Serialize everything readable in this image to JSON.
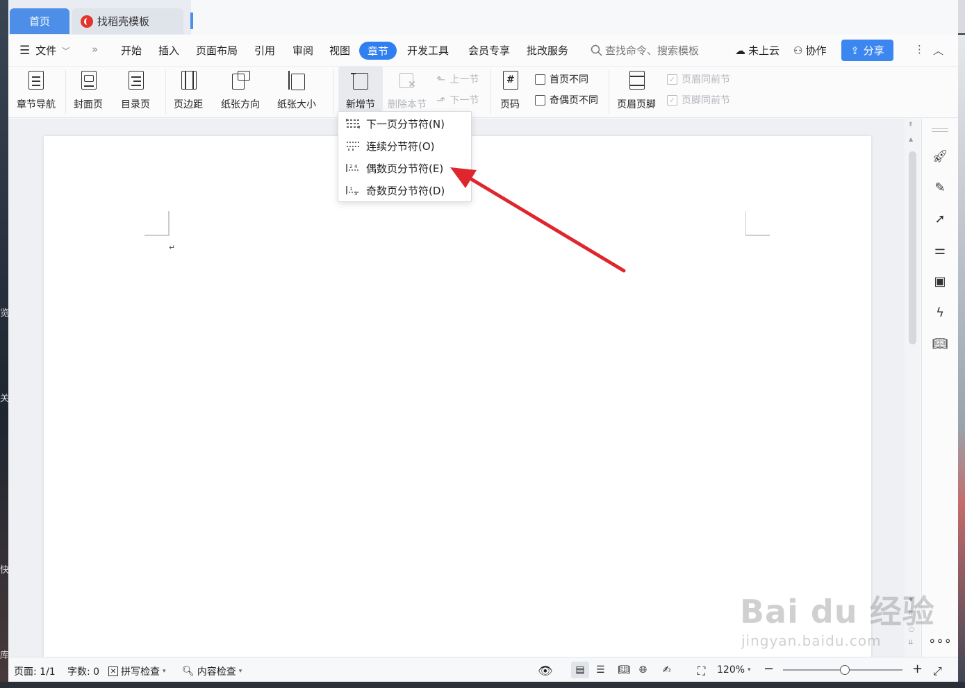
{
  "window": {
    "tabs": [
      {
        "label": "首页"
      },
      {
        "label": "找稻壳模板"
      }
    ]
  },
  "menubar": {
    "file": "文件",
    "items": [
      "开始",
      "插入",
      "页面布局",
      "引用",
      "审阅",
      "视图"
    ],
    "active": "章节",
    "items_after": [
      "开发工具",
      "会员专享",
      "批改服务"
    ],
    "search_placeholder": "查找命令、搜索模板",
    "cloud": "未上云",
    "collab": "协作",
    "share": "分享"
  },
  "ribbon": {
    "nav": "章节导航",
    "cover": "封面页",
    "toc": "目录页",
    "margin": "页边距",
    "orientation": "纸张方向",
    "size": "纸张大小",
    "new_section": "新增节",
    "delete_section": "删除本节",
    "prev_section": "上一节",
    "next_section": "下一节",
    "page_number": "页码",
    "first_page_diff": "首页不同",
    "odd_even_diff": "奇偶页不同",
    "header_footer": "页眉页脚",
    "header_same_prev": "页眉同前节",
    "footer_same_prev": "页脚同前节"
  },
  "dropdown": {
    "items": [
      {
        "label": "下一页分节符(N)"
      },
      {
        "label": "连续分节符(O)"
      },
      {
        "label": "偶数页分节符(E)"
      },
      {
        "label": "奇数页分节符(D)"
      }
    ]
  },
  "document": {
    "paragraph_mark": "↵"
  },
  "statusbar": {
    "page": "页面: 1/1",
    "words": "字数: 0",
    "spell": "拼写检查",
    "content_check": "内容检查",
    "zoom": "120%",
    "zoom_fraction": 0.52
  },
  "watermark": {
    "main": "Bai du 经验",
    "sub": "jingyan.baidu.com"
  },
  "desktop": {
    "edge_chars": [
      "览",
      "关",
      "快",
      "库"
    ]
  },
  "colors": {
    "accent": "#2f7ff0",
    "arrow": "#e0262d"
  }
}
